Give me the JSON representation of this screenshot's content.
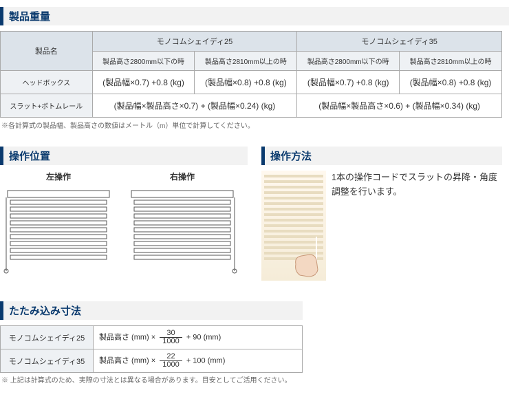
{
  "sections": {
    "weight_title": "製品重量",
    "position_title": "操作位置",
    "method_title": "操作方法",
    "fold_title": "たたみ込み寸法"
  },
  "weight_table": {
    "h_product": "製品名",
    "h_item1": "モノコムシェイディ25",
    "h_item2": "モノコムシェイディ35",
    "sub1": "製品高さ2800mm以下の時",
    "sub2": "製品高さ2810mm以上の時",
    "sub3": "製品高さ2800mm以下の時",
    "sub4": "製品高さ2810mm以上の時",
    "row1_label": "ヘッドボックス",
    "row1_c1": "(製品幅×0.7) +0.8 (kg)",
    "row1_c2": "(製品幅×0.8) +0.8 (kg)",
    "row1_c3": "(製品幅×0.7) +0.8 (kg)",
    "row1_c4": "(製品幅×0.8) +0.8 (kg)",
    "row2_label": "スラット+ボトムレール",
    "row2_c1": "(製品幅×製品高さ×0.7) + (製品幅×0.24) (kg)",
    "row2_c2": "(製品幅×製品高さ×0.6) + (製品幅×0.34) (kg)"
  },
  "weight_note": "※各計算式の製品幅、製品高さの数値はメートル（m）単位で計算してください。",
  "position": {
    "left_label": "左操作",
    "right_label": "右操作"
  },
  "method": {
    "description": "1本の操作コードでスラットの昇降・角度調整を行います。"
  },
  "fold_table": {
    "row1_label": "モノコムシェイディ25",
    "row1_prefix": "製品高さ (mm) ×",
    "row1_num": "30",
    "row1_den": "1000",
    "row1_suffix": "+ 90 (mm)",
    "row2_label": "モノコムシェイディ35",
    "row2_prefix": "製品高さ (mm) ×",
    "row2_num": "22",
    "row2_den": "1000",
    "row2_suffix": "+ 100 (mm)"
  },
  "fold_note": "※ 上記は計算式のため、実際の寸法とは異なる場合があります。目安としてご活用ください。"
}
